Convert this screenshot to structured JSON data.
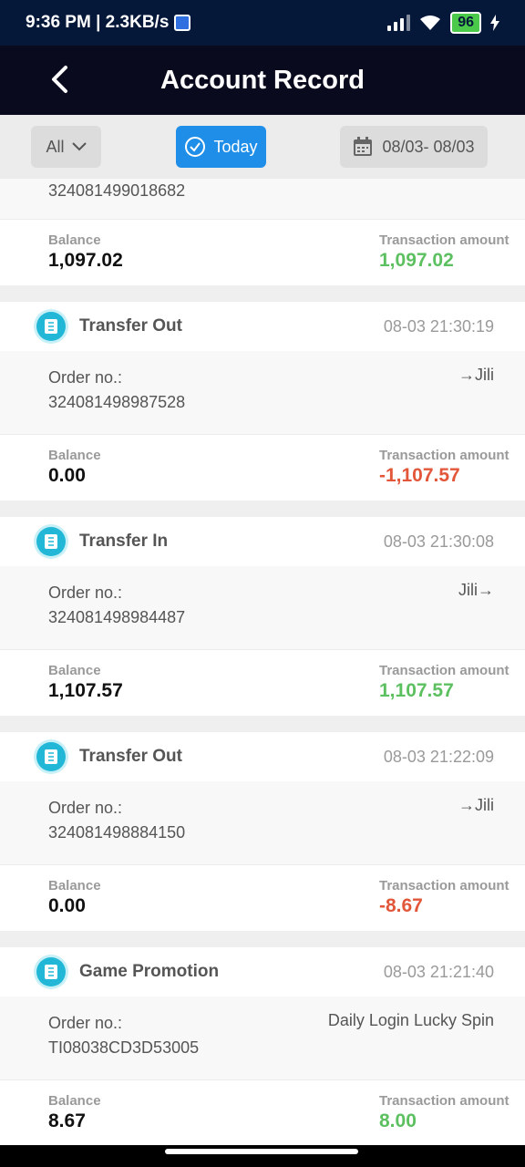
{
  "status_bar": {
    "time": "9:36 PM | 2.3KB/s",
    "battery": "96"
  },
  "header": {
    "title": "Account Record"
  },
  "filters": {
    "all_label": "All",
    "today_label": "Today",
    "date_range": "08/03- 08/03"
  },
  "labels": {
    "order_no": "Order no.:",
    "balance": "Balance",
    "transaction_amount": "Transaction amount"
  },
  "records": [
    {
      "order_id": "324081499018682",
      "balance": "1,097.02",
      "amount": "1,097.02"
    },
    {
      "type": "Transfer Out",
      "time": "08-03 21:30:19",
      "order_id": "324081498987528",
      "target": "→Jili",
      "balance": "0.00",
      "amount": "-1,107.57"
    },
    {
      "type": "Transfer In",
      "time": "08-03 21:30:08",
      "order_id": "324081498984487",
      "target": "Jili→",
      "balance": "1,107.57",
      "amount": "1,107.57"
    },
    {
      "type": "Transfer Out",
      "time": "08-03 21:22:09",
      "order_id": "324081498884150",
      "target": "→Jili",
      "balance": "0.00",
      "amount": "-8.67"
    },
    {
      "type": "Game Promotion",
      "time": "08-03 21:21:40",
      "order_id": "TI08038CD3D53005",
      "target": "Daily Login Lucky Spin",
      "balance": "8.67",
      "amount": "8.00"
    }
  ],
  "colors": {
    "header_bg": "#0a0a1e",
    "accent": "#1f8ee8",
    "positive": "#5cc060",
    "negative": "#e2573a"
  }
}
